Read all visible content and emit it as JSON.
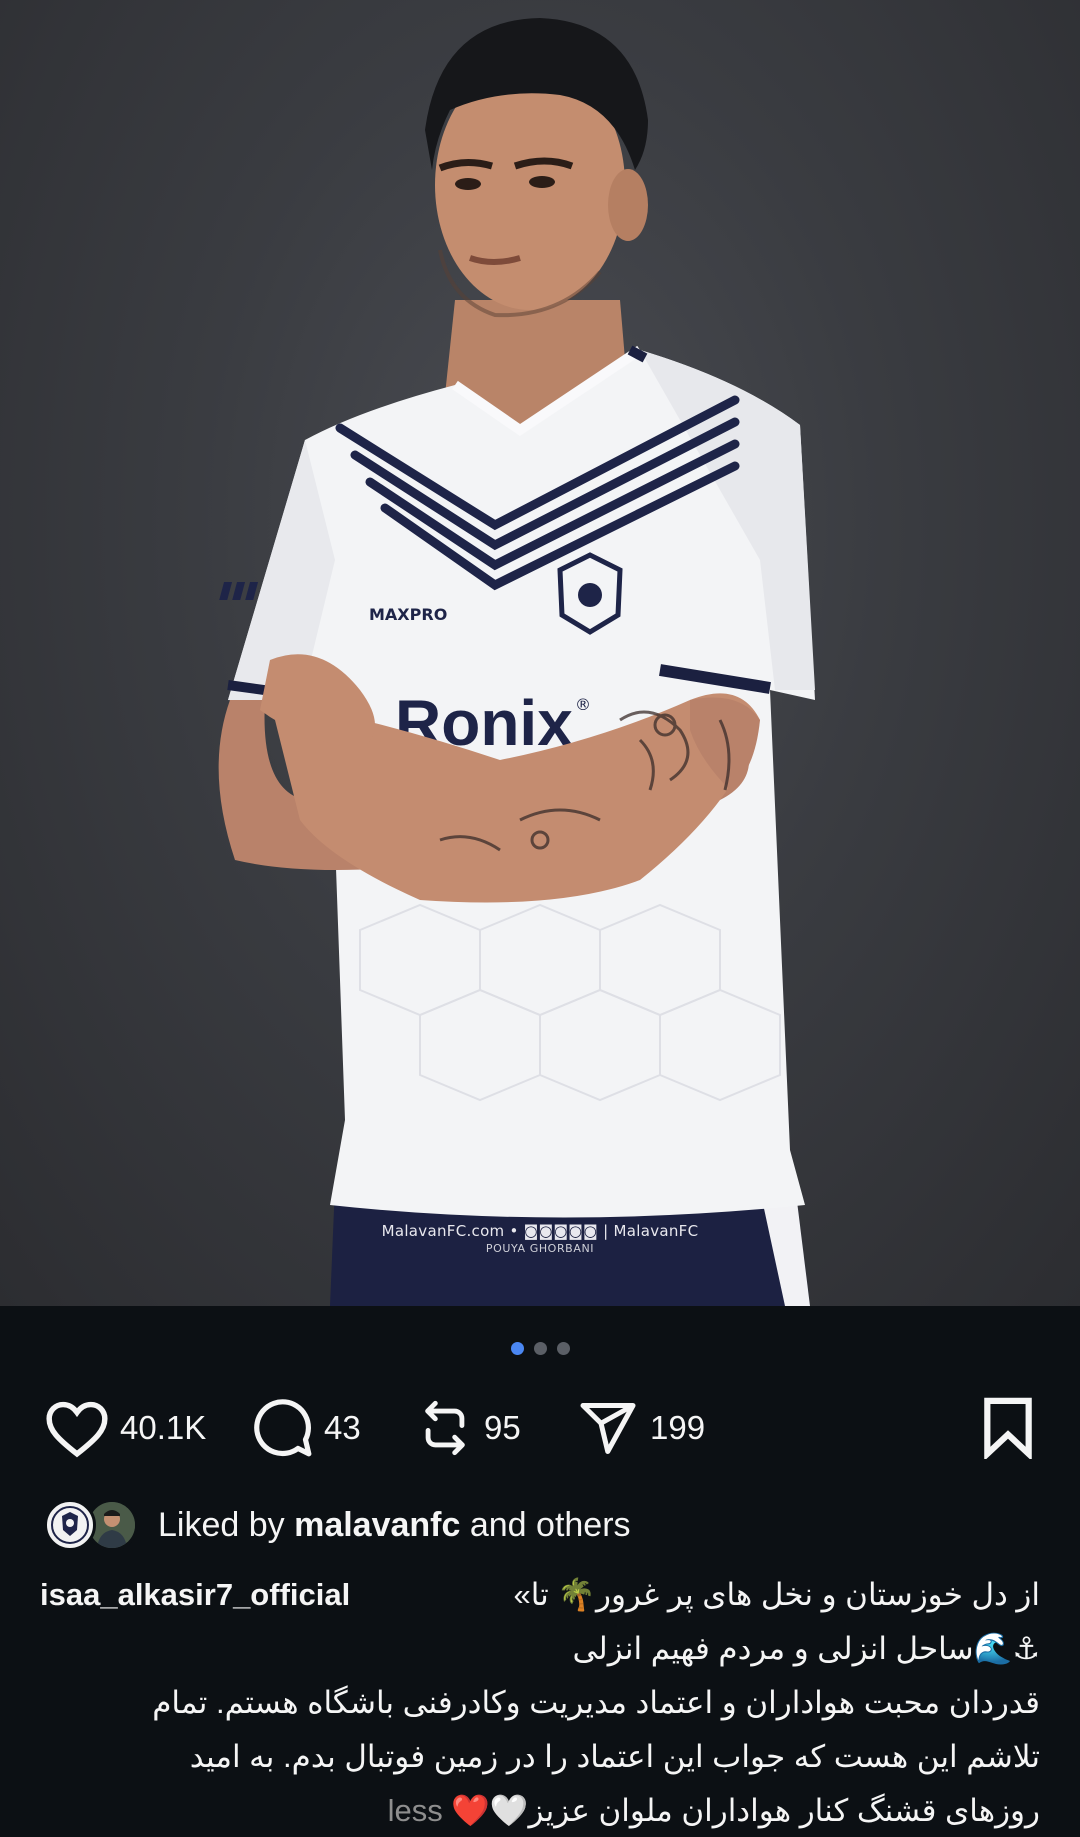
{
  "photo": {
    "alt_subject": "player",
    "watermark_line1": "MalavanFC.com • ◙◙◙◙◙ | MalavanFC",
    "watermark_line2": "POUYA GHORBANI",
    "jersey_brand": "MAXPRO",
    "jersey_sponsor": "Ronix"
  },
  "carousel": {
    "count": 3,
    "active": 0
  },
  "actions": {
    "likes": "40.1K",
    "comments": "43",
    "reposts": "95",
    "shares": "199"
  },
  "liked_by": {
    "prefix": "Liked by ",
    "user": "malavanfc",
    "suffix": " and others"
  },
  "caption": {
    "username": "isaa_alkasir7_official",
    "line1": "از دل خوزستان و نخل های پر غرور🌴 تا»",
    "line2": "⚓🌊ساحل انزلی و مردم فهیم انزلی",
    "line3": "قدردان محبت هواداران و اعتماد مدیریت وکادرفنی باشگاه هستم. تمام",
    "line4": "تلاشم این هست که جواب این اعتماد را در زمین فوتبال بدم. به امید",
    "line5": "روزهای قشنگ کنار هواداران  ملوان عزیز🤍❤️",
    "less": "less"
  },
  "colors": {
    "background": "#0c1014",
    "accent_dot": "#4b87f2",
    "muted": "#8e8e8e"
  },
  "icons": [
    "heart-icon",
    "comment-icon",
    "repost-icon",
    "share-icon",
    "bookmark-icon"
  ]
}
